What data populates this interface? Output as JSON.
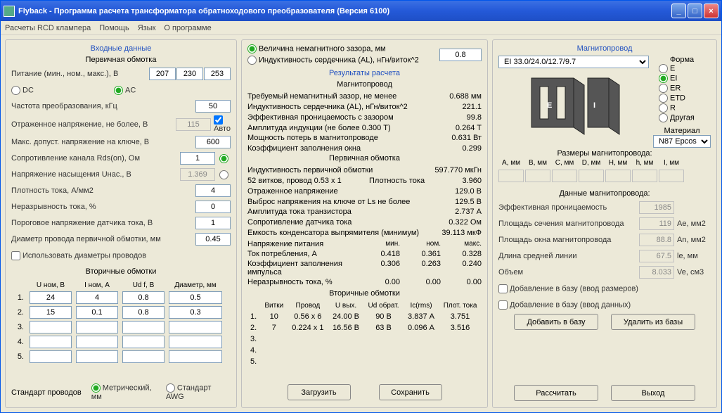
{
  "window": {
    "title": "Flyback - Программа расчета трансформатора обратноходового преобразователя (Версия 6100)"
  },
  "menu": {
    "rcd": "Расчеты RCD клампера",
    "help": "Помощь",
    "lang": "Язык",
    "about": "О программе"
  },
  "left": {
    "title": "Входные данные",
    "primary_title": "Первичная обмотка",
    "supply_label": "Питание (мин., ном., макс.), В",
    "supply_min": "207",
    "supply_nom": "230",
    "supply_max": "253",
    "dc": "DC",
    "ac": "AC",
    "freq_label": "Частота преобразования, кГц",
    "freq": "50",
    "refl_label": "Отраженное напряжение, не более, В",
    "refl": "115",
    "auto": "Авто",
    "vmax_label": "Макс. допуст. напряжение на ключе, В",
    "vmax": "600",
    "rds_label": "Сопротивление канала Rds(on), Ом",
    "rds": "1",
    "unas_label": "Напряжение насыщения Uнас., В",
    "unas": "1.369",
    "jdens_label": "Плотность тока, А/мм2",
    "jdens": "4",
    "discont_label": "Неразрывность тока, %",
    "discont": "0",
    "thresh_label": "Пороговое напряжение датчика тока, В",
    "thresh": "1",
    "dwire_label": "Диаметр провода первичной обмотки, мм",
    "dwire": "0.45",
    "use_diam": "Использовать диаметры проводов",
    "sec_title": "Вторичные обмотки",
    "h_u": "U ном, В",
    "h_i": "I ном, А",
    "h_ud": "Ud f, В",
    "h_d": "Диаметр, мм",
    "r1": {
      "u": "24",
      "i": "4",
      "ud": "0.8",
      "d": "0.5"
    },
    "r2": {
      "u": "15",
      "i": "0.1",
      "ud": "0.8",
      "d": "0.3"
    },
    "wire_std_label": "Стандарт проводов",
    "wire_metric": "Метрический, мм",
    "wire_awg": "Стандарт AWG"
  },
  "mid": {
    "gap_radio": "Величина немагнитного зазора, мм",
    "al_radio": "Индуктивность сердечника (AL), нГн/виток^2",
    "gap_value": "0.8",
    "results_title": "Результаты расчета",
    "core_title": "Магнитопровод",
    "req_gap": "Требуемый немагнитный зазор, не менее",
    "req_gap_v": "0.688 мм",
    "al": "Индуктивность сердечника (AL), нГн/виток^2",
    "al_v": "221.1",
    "eff_perm": "Эффективная проницаемость с зазором",
    "eff_perm_v": "99.8",
    "bamp": "Амплитуда индукции        (не более 0.300 Т)",
    "bamp_v": "0.264 T",
    "ploss": "Мощность потерь в магнитопроводе",
    "ploss_v": "0.631 Вт",
    "kwin": "Коэффициент заполнения окна",
    "kwin_v": "0.299",
    "prim_title": "Первичная обмотка",
    "lp": "Индуктивность первичной обмотки",
    "lp_v": "597.770 мкГн",
    "turns": "    52 витков, провод 0.53 x 1",
    "turns_l": "Плотность тока",
    "turns_v": "3.960",
    "vrefl2": "Отраженное напряжение",
    "vrefl2_v": "129.0 В",
    "vspike": "Выброс напряжения на ключе от Ls не более",
    "vspike_v": "129.5 В",
    "ipk": "Амплитуда тока транзистора",
    "ipk_v": "2.737 А",
    "rsense": "Сопротивление датчика тока",
    "rsense_v": "0.322 Ом",
    "cout": "Емкость конденсатора выпрямителя (минимум)",
    "cout_v": "39.113 мкФ",
    "vsupply_h": "Напряжение питания",
    "min_h": "мин.",
    "nom_h": "ном.",
    "max_h": "макс.",
    "iin": "Ток потребления, А",
    "iin_min": "0.418",
    "iin_nom": "0.361",
    "iin_max": "0.328",
    "duty": "Коэффициент заполнения импульса",
    "duty_min": "0.306",
    "duty_nom": "0.263",
    "duty_max": "0.240",
    "disc": "Неразрывность тока, %",
    "disc_min": "0.00",
    "disc_nom": "0.00",
    "disc_max": "0.00",
    "sec_title": "Вторичные обмотки",
    "sh_turns": "Витки",
    "sh_wire": "Провод",
    "sh_uout": "U вых.",
    "sh_ud": "Ud обрат.",
    "sh_ic": "Ic(rms)",
    "sh_j": "Плот. тока",
    "s1": {
      "n": "1.",
      "t": "10",
      "w": "0.56 x 6",
      "u": "24.00 В",
      "ud": "90 В",
      "ic": "3.837 А",
      "j": "3.751"
    },
    "s2": {
      "n": "2.",
      "t": "7",
      "w": "0.224 x 1",
      "u": "16.56 В",
      "ud": "63 В",
      "ic": "0.096 А",
      "j": "3.516"
    },
    "btn_load": "Загрузить",
    "btn_save": "Сохранить"
  },
  "right": {
    "title": "Магнитопровод",
    "core_select": "EI 33.0/24.0/12.7/9.7",
    "shape_label": "Форма",
    "shape_e": "E",
    "shape_ei": "EI",
    "shape_er": "ER",
    "shape_etd": "ETD",
    "shape_r": "R",
    "shape_other": "Другая",
    "mat_label": "Материал",
    "mat": "N87 Epcos",
    "dims_label": "Размеры магнитопровода:",
    "da": "A, мм",
    "db": "B, мм",
    "dc": "C, мм",
    "dd": "D, мм",
    "dh": "H, мм",
    "dh2": "h, мм",
    "di": "I, мм",
    "coredata_title": "Данные магнитопровода:",
    "mu": "Эффективная проницаемость",
    "mu_v": "1985",
    "ae": "Площадь сечения магнитопровода",
    "ae_v": "119",
    "ae_u": "Ae, мм2",
    "an": "Площадь окна магнитопровода",
    "an_v": "88.8",
    "an_u": "An, мм2",
    "le": "Длина средней линии",
    "le_v": "67.5",
    "le_u": "le, мм",
    "ve": "Объем",
    "ve_v": "8.033",
    "ve_u": "Ve, см3",
    "cb_add_dims": "Добавление в базу (ввод размеров)",
    "cb_add_data": "Добавление в базу (ввод данных)",
    "btn_add": "Добавить в базу",
    "btn_del": "Удалить из базы",
    "btn_calc": "Рассчитать",
    "btn_exit": "Выход"
  }
}
